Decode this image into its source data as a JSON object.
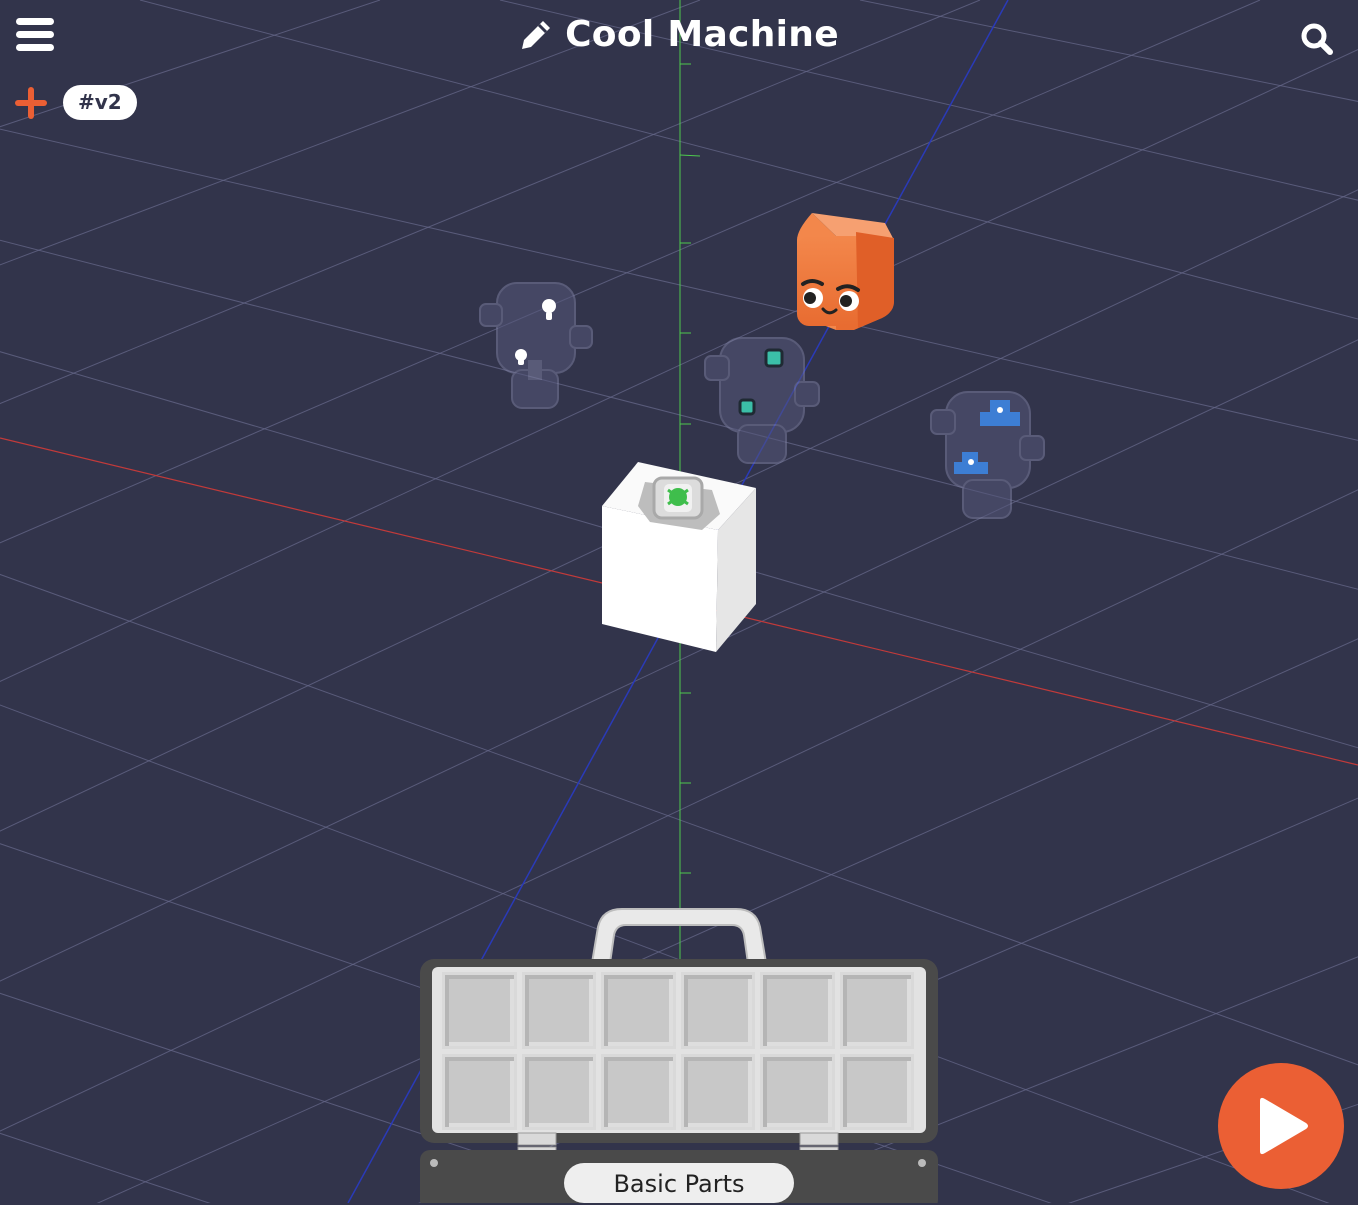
{
  "app": {
    "title": "Cool Machine",
    "version_tag": "#v2"
  },
  "toolbox": {
    "label": "Basic Parts",
    "slot_rows": 2,
    "slot_columns": 6
  },
  "colors": {
    "background": "#32344b",
    "accent": "#eb5f34",
    "grid_line": "#6a6c86",
    "x_axis": "#c23a3a",
    "y_axis": "#4ec94e",
    "z_axis": "#2a3ab8",
    "orange_block": "#f07d3e",
    "white_block": "#ffffff",
    "ghost_block": "#55577a",
    "ghost_blue": "#3d7ed4",
    "ghost_teal": "#3bbfa8"
  },
  "icons": {
    "menu": "hamburger-menu-icon",
    "edit": "pencil-icon",
    "search": "search-icon",
    "add": "plus-icon",
    "play": "play-icon"
  },
  "scene_objects": [
    {
      "name": "orange-character-block",
      "kind": "character"
    },
    {
      "name": "white-starter-block",
      "kind": "block"
    },
    {
      "name": "ghost-lightbulb-part",
      "kind": "ghost-hint"
    },
    {
      "name": "ghost-teal-part",
      "kind": "ghost-hint"
    },
    {
      "name": "ghost-blue-part",
      "kind": "ghost-hint"
    }
  ]
}
